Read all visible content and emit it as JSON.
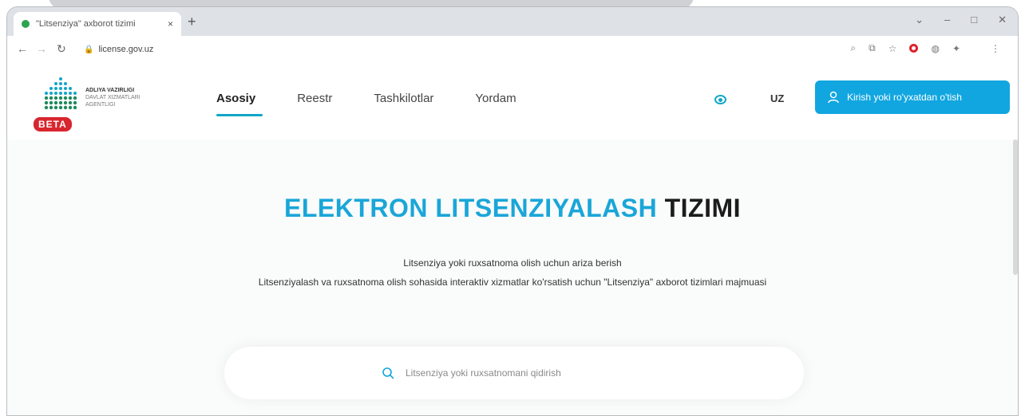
{
  "browser": {
    "tab_title": "\"Litsenziya\" axborot tizimi",
    "tab_close": "×",
    "new_tab": "+",
    "url": "license.gov.uz",
    "window_controls": [
      "⌄",
      "–",
      "□",
      "✕"
    ]
  },
  "header": {
    "org_line1": "ADLIYA VAZIRLIGI",
    "org_line2": "DAVLAT XIZMATLARI",
    "org_line3": "AGENTLIGI",
    "beta_badge": "BETA",
    "nav": [
      {
        "label": "Asosiy",
        "active": true
      },
      {
        "label": "Reestr",
        "active": false
      },
      {
        "label": "Tashkilotlar",
        "active": false
      },
      {
        "label": "Yordam",
        "active": false
      }
    ],
    "language": "UZ",
    "login_label": "Kirish yoki ro'yxatdan o'tish"
  },
  "hero": {
    "title_accent": "ELEKTRON LITSENZIYALASH",
    "title_dark": "TIZIMI",
    "subtitle1": "Litsenziya yoki ruxsatnoma olish uchun ariza berish",
    "subtitle2": "Litsenziyalash va ruxsatnoma olish sohasida interaktiv xizmatlar ko'rsatish uchun \"Litsenziya\" axborot tizimlari majmuasi"
  },
  "search": {
    "placeholder": "Litsenziya yoki ruxsatnomani qidirish"
  },
  "colors": {
    "accent": "#11a6e0",
    "beta": "#d8262f",
    "logo_teal": "#11a6c7",
    "logo_green": "#1f8a5a"
  }
}
